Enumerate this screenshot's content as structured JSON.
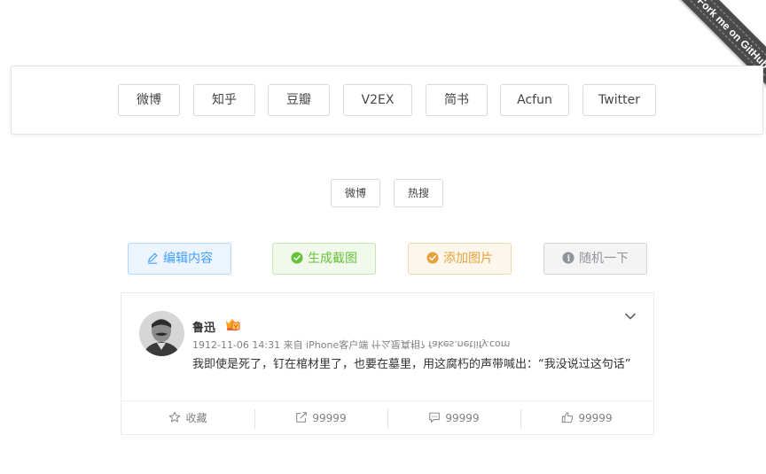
{
  "ribbon": {
    "label": "Fork me on GitHub"
  },
  "site_tabs": [
    {
      "label": "微博"
    },
    {
      "label": "知乎"
    },
    {
      "label": "豆瓣"
    },
    {
      "label": "V2EX"
    },
    {
      "label": "简书"
    },
    {
      "label": "Acfun"
    },
    {
      "label": "Twitter"
    }
  ],
  "sub_tabs": [
    {
      "label": "微博"
    },
    {
      "label": "热搜"
    }
  ],
  "actions": {
    "edit": {
      "label": "编辑内容",
      "icon": "pencil-icon",
      "color": "#409eff"
    },
    "screenshot": {
      "label": "生成截图",
      "icon": "check-circle-icon",
      "color": "#67c23a"
    },
    "add_image": {
      "label": "添加图片",
      "icon": "check-circle-icon",
      "color": "#e6a23c"
    },
    "random": {
      "label": "随机一下",
      "icon": "info-circle-icon",
      "color": "#909399"
    }
  },
  "post": {
    "username": "鲁迅",
    "timestamp": "1912-11-06 14:31",
    "source": "来自 iPhone客户端",
    "mirrored_note": "什么是真相? fakes.netlify.com",
    "text": "我即使是死了，钉在棺材里了，也要在墓里，用这腐朽的声带喊出：“我没说过这句话”",
    "footer": {
      "favorite": "收藏",
      "repost": "99999",
      "comment": "99999",
      "like": "99999"
    }
  }
}
